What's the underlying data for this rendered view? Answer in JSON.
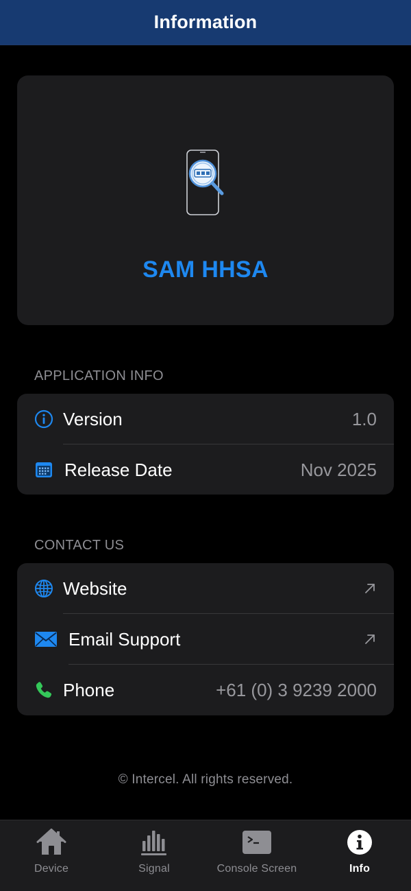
{
  "nav": {
    "title": "Information"
  },
  "hero": {
    "app_name": "SAM HHSA",
    "icon": "phone-search-icon"
  },
  "application_info": {
    "header": "APPLICATION INFO",
    "rows": [
      {
        "label": "Version",
        "value": "1.0",
        "icon": "info-circle-icon"
      },
      {
        "label": "Release Date",
        "value": "Nov 2025",
        "icon": "calendar-icon"
      }
    ]
  },
  "contact_us": {
    "header": "CONTACT US",
    "rows": [
      {
        "label": "Website",
        "icon": "globe-icon",
        "action": "external-link-icon"
      },
      {
        "label": "Email Support",
        "icon": "envelope-icon",
        "action": "external-link-icon"
      },
      {
        "label": "Phone",
        "value": "+61 (0) 3 9239 2000",
        "icon": "phone-icon"
      }
    ]
  },
  "footer": {
    "text": "© Intercel. All rights reserved."
  },
  "tab_bar": {
    "active": "Info",
    "tabs": [
      {
        "label": "Device",
        "icon": "house-icon"
      },
      {
        "label": "Signal",
        "icon": "bar-chart-icon"
      },
      {
        "label": "Console Screen",
        "icon": "terminal-icon"
      },
      {
        "label": "Info",
        "icon": "info-icon"
      }
    ]
  },
  "colors": {
    "nav_background": "#173a71",
    "accent": "#1e88f0",
    "card_background": "#1c1c1e",
    "phone_green": "#34c759"
  }
}
